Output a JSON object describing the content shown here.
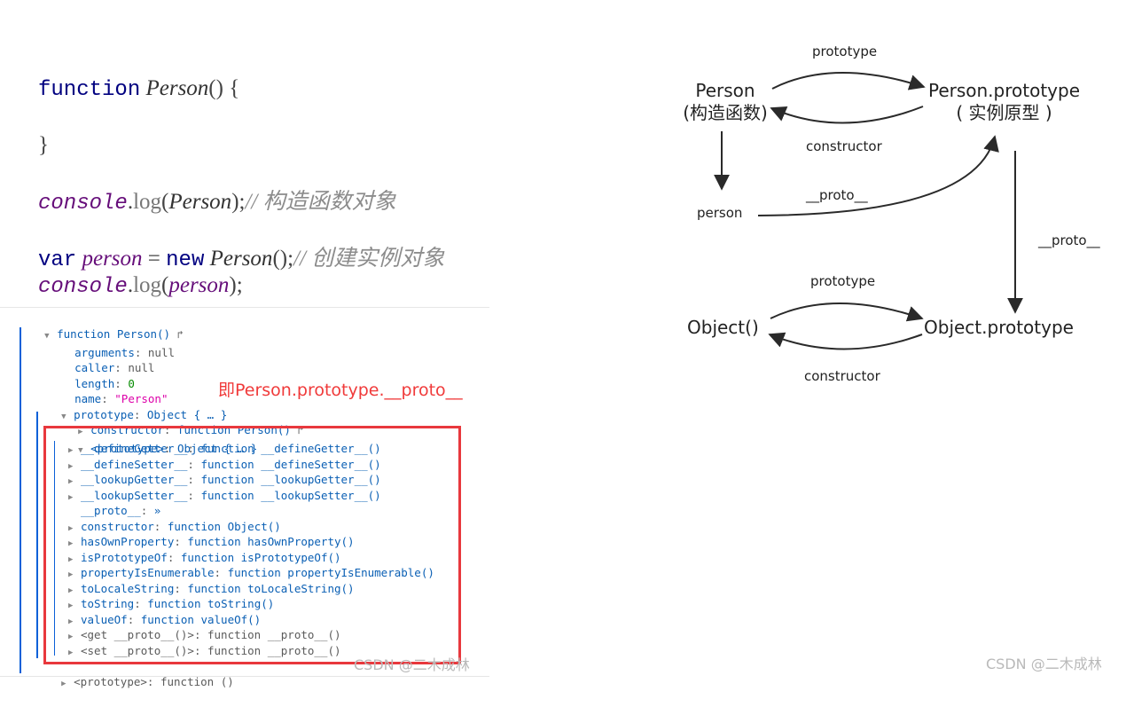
{
  "code": {
    "line1": {
      "kw": "function",
      "name": "Person",
      "rest": "() {"
    },
    "line2": {
      "brace": "}"
    },
    "line3": {
      "obj": "console",
      "dot": ".",
      "method": "log",
      "open": "(",
      "arg": "Person",
      "close": ");",
      "comment": "// 构造函数对象"
    },
    "line4": {
      "kw": "var",
      "name": "person",
      "eq": " = ",
      "kw2": "new",
      "ctor": "Person",
      "rest": "();",
      "comment": "// 创建实例对象"
    },
    "line5": {
      "obj": "console",
      "dot": ".",
      "method": "log",
      "open": "(",
      "arg": "person",
      "close": ");"
    }
  },
  "devtools": {
    "root": {
      "label": "function Person()",
      "jump": "↱"
    },
    "props": [
      {
        "key": "arguments",
        "value": "null",
        "type": "null"
      },
      {
        "key": "caller",
        "value": "null",
        "type": "null"
      },
      {
        "key": "length",
        "value": "0",
        "type": "num"
      },
      {
        "key": "name",
        "value": "\"Person\"",
        "type": "str"
      }
    ],
    "prototype": {
      "key": "prototype",
      "value": "Object { … }"
    },
    "constructor": {
      "key": "constructor",
      "value": "function Person()",
      "jump": "↱"
    },
    "inner_prototype": {
      "key": "<prototype>",
      "value": "Object { … }"
    },
    "inner_items": [
      {
        "key": "__defineGetter__",
        "value": "function __defineGetter__()",
        "expandable": true
      },
      {
        "key": "__defineSetter__",
        "value": "function __defineSetter__()",
        "expandable": true
      },
      {
        "key": "__lookupGetter__",
        "value": "function __lookupGetter__()",
        "expandable": true
      },
      {
        "key": "__lookupSetter__",
        "value": "function __lookupSetter__()",
        "expandable": true
      },
      {
        "key": "__proto__",
        "value": "»",
        "expandable": false
      },
      {
        "key": "constructor",
        "value": "function Object()",
        "expandable": true
      },
      {
        "key": "hasOwnProperty",
        "value": "function hasOwnProperty()",
        "expandable": true
      },
      {
        "key": "isPrototypeOf",
        "value": "function isPrototypeOf()",
        "expandable": true
      },
      {
        "key": "propertyIsEnumerable",
        "value": "function propertyIsEnumerable()",
        "expandable": true
      },
      {
        "key": "toLocaleString",
        "value": "function toLocaleString()",
        "expandable": true
      },
      {
        "key": "toString",
        "value": "function toString()",
        "expandable": true
      },
      {
        "key": "valueOf",
        "value": "function valueOf()",
        "expandable": true
      },
      {
        "key": "<get __proto__()>",
        "value": "function __proto__()",
        "expandable": true,
        "gray": true
      },
      {
        "key": "<set __proto__()>",
        "value": "function __proto__()",
        "expandable": true,
        "gray": true
      }
    ],
    "outer_prototype": {
      "key": "<prototype>",
      "value": "function ()"
    },
    "annotation": "即Person.prototype.__proto__",
    "highlight_color": "#e8383d"
  },
  "diagram": {
    "nodes": {
      "person_ctor": {
        "line1": "Person",
        "line2": "(构造函数)"
      },
      "person_proto": {
        "line1": "Person.prototype",
        "line2": "( 实例原型 )"
      },
      "person_instance": {
        "label": "person"
      },
      "object_ctor": {
        "label": "Object()"
      },
      "object_proto": {
        "label": "Object.prototype"
      }
    },
    "edges": {
      "prototype_top": "prototype",
      "constructor_top": "constructor",
      "proto_instance": "__proto__",
      "proto_chain": "__proto__",
      "prototype_bottom": "prototype",
      "constructor_bottom": "constructor"
    }
  },
  "watermarks": {
    "left": "CSDN @二木成林",
    "right": "CSDN @二木成林"
  }
}
